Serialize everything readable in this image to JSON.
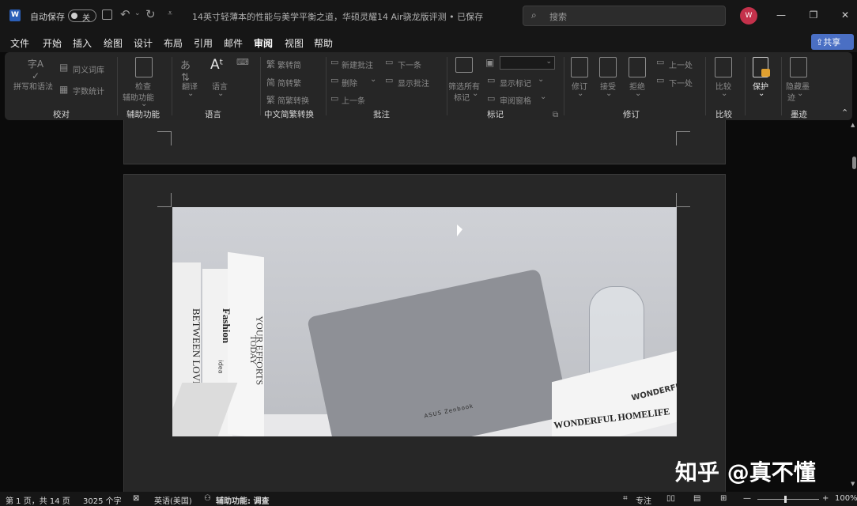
{
  "titlebar": {
    "autosave_label": "自动保存",
    "autosave_state": "关",
    "doc_title": "14英寸轻薄本的性能与美学平衡之道，华硕灵耀14 Air骁龙版评测 • 已保存",
    "search_placeholder": "搜索",
    "avatar_initial": "W"
  },
  "menu_tabs": [
    "文件",
    "开始",
    "插入",
    "绘图",
    "设计",
    "布局",
    "引用",
    "邮件",
    "审阅",
    "视图",
    "帮助"
  ],
  "share_label": "共享",
  "ribbon": {
    "proofing": {
      "spell": "拼写和语法",
      "thesaurus": "同义词库",
      "word_count": "字数统计",
      "group": "校对"
    },
    "accessibility": {
      "check": "检查",
      "check2": "辅助功能",
      "group": "辅助功能"
    },
    "language": {
      "translate": "翻译",
      "language": "语言",
      "group": "语言"
    },
    "chinese": {
      "to_trad": "繁转简",
      "to_simp": "简转繁",
      "convert": "简繁转换",
      "group": "中文简繁转换"
    },
    "comments": {
      "new": "新建批注",
      "delete": "删除",
      "prev": "上一条",
      "next": "下一条",
      "show": "显示批注",
      "group": "批注"
    },
    "tracking": {
      "filter": "筛选所有",
      "filter2": "标记",
      "show_markup": "显示标记",
      "pane": "审阅窗格",
      "group": "标记"
    },
    "changes": {
      "track": "修订",
      "accept": "接受",
      "reject": "拒绝",
      "prev": "上一处",
      "next": "下一处",
      "group": "修订"
    },
    "compare": {
      "compare": "比较",
      "group": "比较"
    },
    "protect": {
      "protect": "保护"
    },
    "ink": {
      "hide": "隐藏墨",
      "hide2": "迹",
      "group": "墨迹"
    }
  },
  "photo": {
    "book1": "BETWEEN LOVE",
    "book2": "Fashion",
    "book2b": "idea",
    "book3": "YOUR EFFORTS",
    "book3b": "TODAY",
    "laptop": "ASUS Zenbook",
    "book4": "WONDERFUL HOMELIFE",
    "book4b": "WONDERFUL"
  },
  "watermark": "知乎 @真不懂",
  "status": {
    "page": "第 1 页，共 14 页",
    "words": "3025 个字",
    "lang": "英语(美国)",
    "access": "辅助功能: 调查",
    "focus": "专注",
    "zoom": "100%"
  }
}
